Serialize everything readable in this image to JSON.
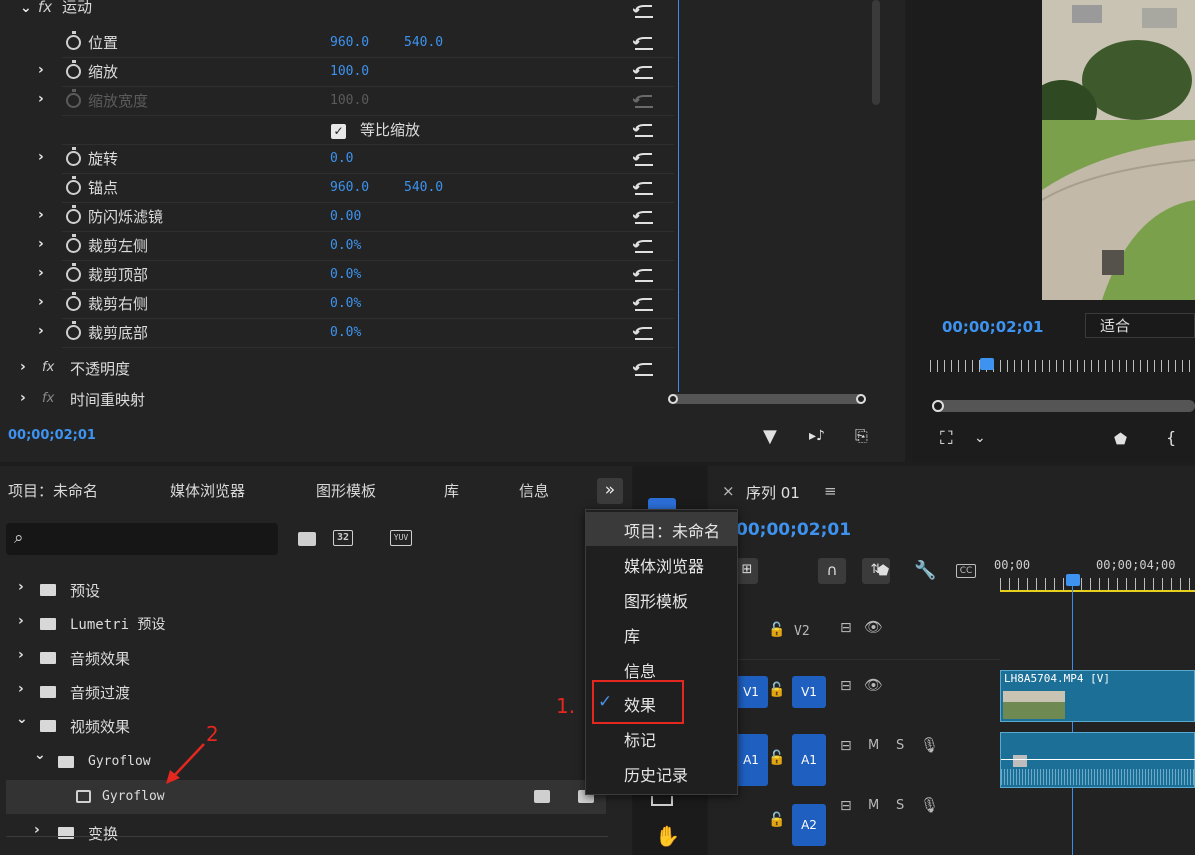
{
  "effect_controls": {
    "motion_header": "运动",
    "properties": [
      {
        "label": "位置",
        "v1": "960.0",
        "v2": "540.0"
      },
      {
        "label": "缩放",
        "v1": "100.0"
      },
      {
        "label": "缩放宽度",
        "v1": "100.0"
      },
      {
        "label": "等比缩放"
      },
      {
        "label": "旋转",
        "v1": "0.0"
      },
      {
        "label": "锚点",
        "v1": "960.0",
        "v2": "540.0"
      },
      {
        "label": "防闪烁滤镜",
        "v1": "0.00"
      },
      {
        "label": "裁剪左侧",
        "v1": "0.0%"
      },
      {
        "label": "裁剪顶部",
        "v1": "0.0%"
      },
      {
        "label": "裁剪右侧",
        "v1": "0.0%"
      },
      {
        "label": "裁剪底部",
        "v1": "0.0%"
      }
    ],
    "opacity_header": "不透明度",
    "time_remap_header": "时间重映射",
    "timecode": "00;00;02;01",
    "fx_glyph": "fx"
  },
  "viewer": {
    "timecode": "00;00;02;01",
    "fit_label": "适合"
  },
  "effects_panel": {
    "tabs": [
      "项目：未命名",
      "媒体浏览器",
      "图形模板",
      "库",
      "信息"
    ],
    "overflow_label": "»",
    "filter_icons": [
      "32",
      "YUV"
    ],
    "tree": [
      {
        "label": "预设",
        "expanded": false,
        "depth": 0
      },
      {
        "label": "Lumetri 预设",
        "expanded": false,
        "depth": 0
      },
      {
        "label": "音频效果",
        "expanded": false,
        "depth": 0
      },
      {
        "label": "音频过渡",
        "expanded": false,
        "depth": 0
      },
      {
        "label": "视频效果",
        "expanded": true,
        "depth": 0
      },
      {
        "label": "Gyroflow",
        "expanded": true,
        "depth": 1
      },
      {
        "label": "Gyroflow",
        "expanded": false,
        "depth": 2
      },
      {
        "label": "变换",
        "expanded": false,
        "depth": 0
      }
    ]
  },
  "menu": {
    "items": [
      {
        "label": "项目：未命名",
        "checked": false
      },
      {
        "label": "媒体浏览器",
        "checked": false
      },
      {
        "label": "图形模板",
        "checked": false
      },
      {
        "label": "库",
        "checked": false
      },
      {
        "label": "信息",
        "checked": false
      },
      {
        "label": "效果",
        "checked": true
      },
      {
        "label": "标记",
        "checked": false
      },
      {
        "label": "历史记录",
        "checked": false
      }
    ]
  },
  "timeline": {
    "close": "×",
    "sequence_title": "序列 01",
    "menu_glyph": "≡",
    "timecode": "00;00;02;01",
    "ruler": [
      "00;00",
      "00;00;04;00"
    ],
    "tracks": [
      {
        "name": "V2",
        "lock": "🔓"
      },
      {
        "name": "V1",
        "target": "V1"
      },
      {
        "name": "A1",
        "target": "A1"
      },
      {
        "name": "A2"
      }
    ],
    "audio_controls": [
      "M",
      "S"
    ],
    "clip_label": "LH8A5704.MP4 [V]"
  },
  "annotations": {
    "step1": "1.",
    "step2": "2"
  },
  "colors": {
    "accent_blue": "#3d93ef",
    "track_blue": "#1f5fc0",
    "annotation_red": "#e4281f",
    "clip_teal": "#1c6f97"
  }
}
